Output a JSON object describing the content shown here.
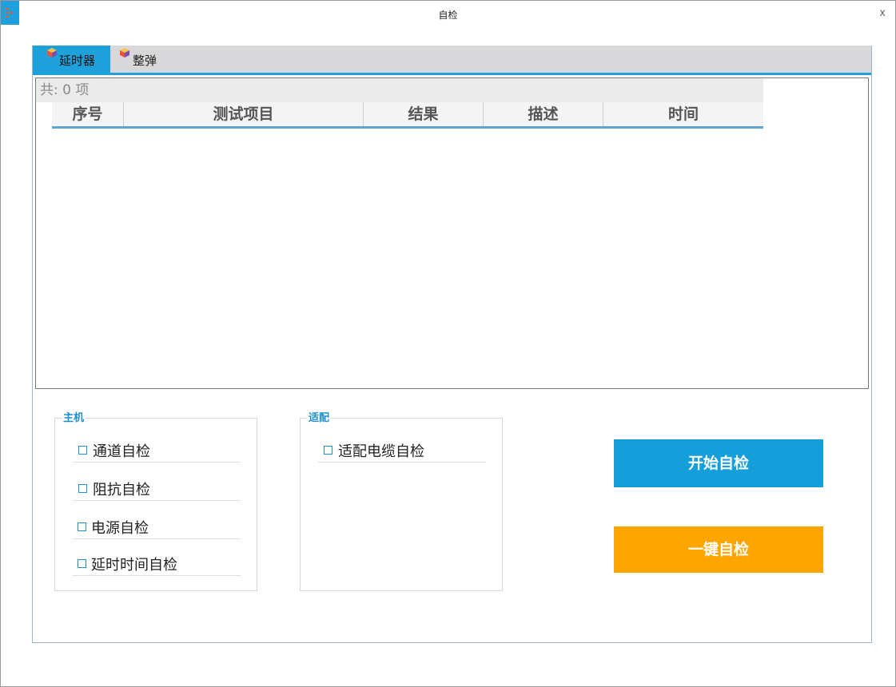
{
  "window": {
    "title": "自检",
    "close_glyph": "x",
    "icon": "app-logo-icon"
  },
  "tabs": [
    {
      "label": "延时器",
      "icon": "cube-icon",
      "active": true
    },
    {
      "label": "整弹",
      "icon": "cube-icon",
      "active": false
    }
  ],
  "grid": {
    "count_text": "共: 0 项",
    "columns": [
      "序号",
      "测试项目",
      "结果",
      "描述",
      "时间"
    ],
    "rows": []
  },
  "host_group": {
    "title": "主机",
    "items": [
      {
        "label": "通道自检",
        "checked": false
      },
      {
        "label": "阻抗自检",
        "checked": false
      },
      {
        "label": "电源自检",
        "checked": false
      },
      {
        "label": "延时时间自检",
        "checked": false
      }
    ]
  },
  "adapter_group": {
    "title": "适配",
    "items": [
      {
        "label": "适配电缆自检",
        "checked": false
      }
    ]
  },
  "buttons": {
    "start_label": "开始自检",
    "onekey_label": "一键自检"
  },
  "colors": {
    "accent": "#1ea0db",
    "start_button": "#149fdb",
    "onekey_button": "#fea500",
    "group_title": "#1b8fd0"
  }
}
